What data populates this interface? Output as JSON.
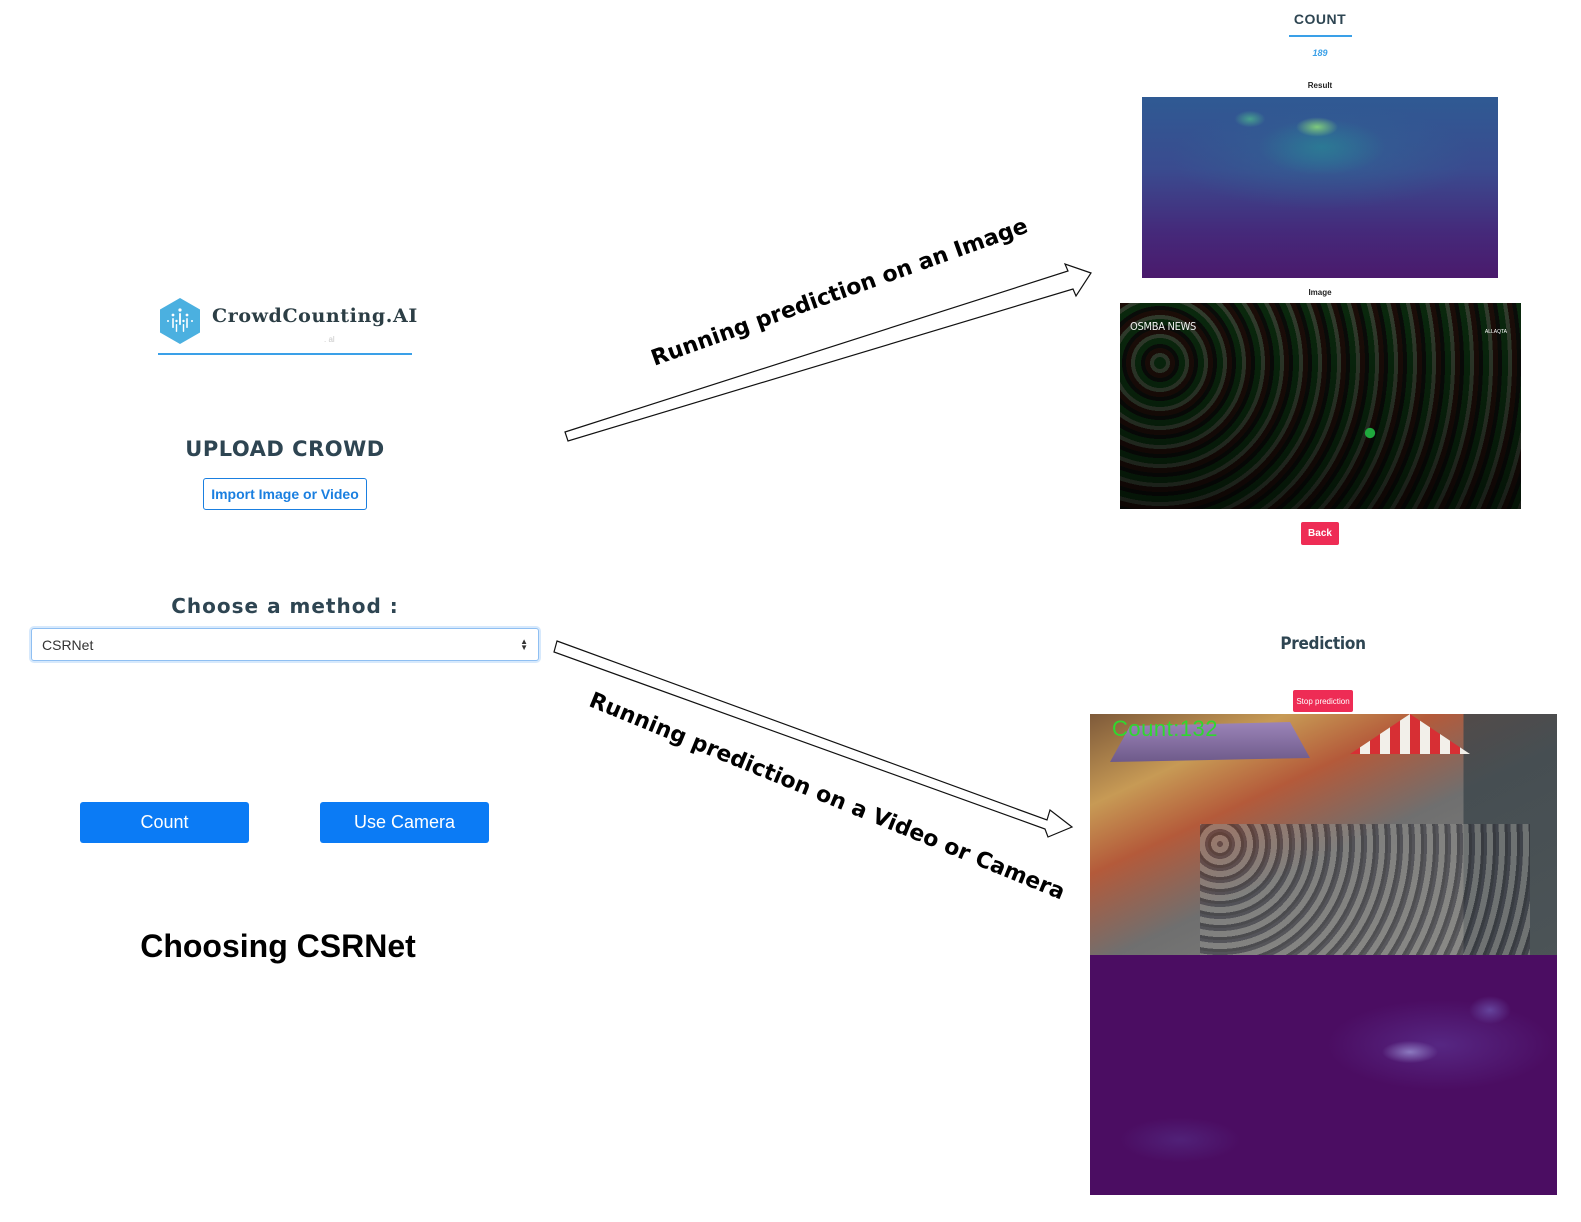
{
  "left_panel": {
    "logo_text": "CrowdCounting.AI",
    "logo_subtext": ". al",
    "upload_title": "UPLOAD CROWD",
    "import_button": "Import Image or Video",
    "method_label": "Choose a method :",
    "method_select": {
      "selected": "CSRNet"
    },
    "count_button": "Count",
    "camera_button": "Use Camera",
    "caption": "Choosing CSRNet"
  },
  "arrows": {
    "image_label": "Running prediction on an Image",
    "video_label": "Running prediction on a Video or Camera"
  },
  "image_result": {
    "count_title": "COUNT",
    "count_value": "189",
    "result_label": "Result",
    "image_label": "Image",
    "watermark": "OSMBA NEWS",
    "watermark_right": "ALLAQTA",
    "back_button": "Back"
  },
  "video_result": {
    "title": "Prediction",
    "stop_button": "Stop prediction",
    "overlay_count": "Count:132"
  },
  "colors": {
    "accent_blue": "#0b7bf5",
    "link_blue": "#1a7fe0",
    "heading_dark": "#2e4552",
    "danger_pink": "#ee2c55",
    "count_green": "#2fd82f",
    "density_purple": "#4b0d62"
  }
}
